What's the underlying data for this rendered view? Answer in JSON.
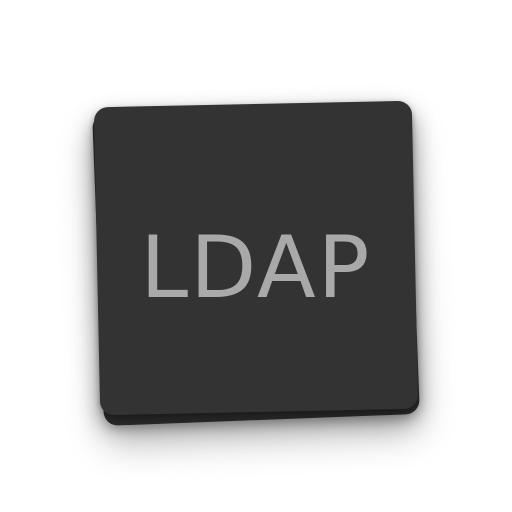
{
  "icon": {
    "text": "LDAP",
    "card_color": "#333333",
    "back_card_color": "#2f2f2f",
    "text_color": "#a9a9a9",
    "background_color": "#ffffff"
  }
}
